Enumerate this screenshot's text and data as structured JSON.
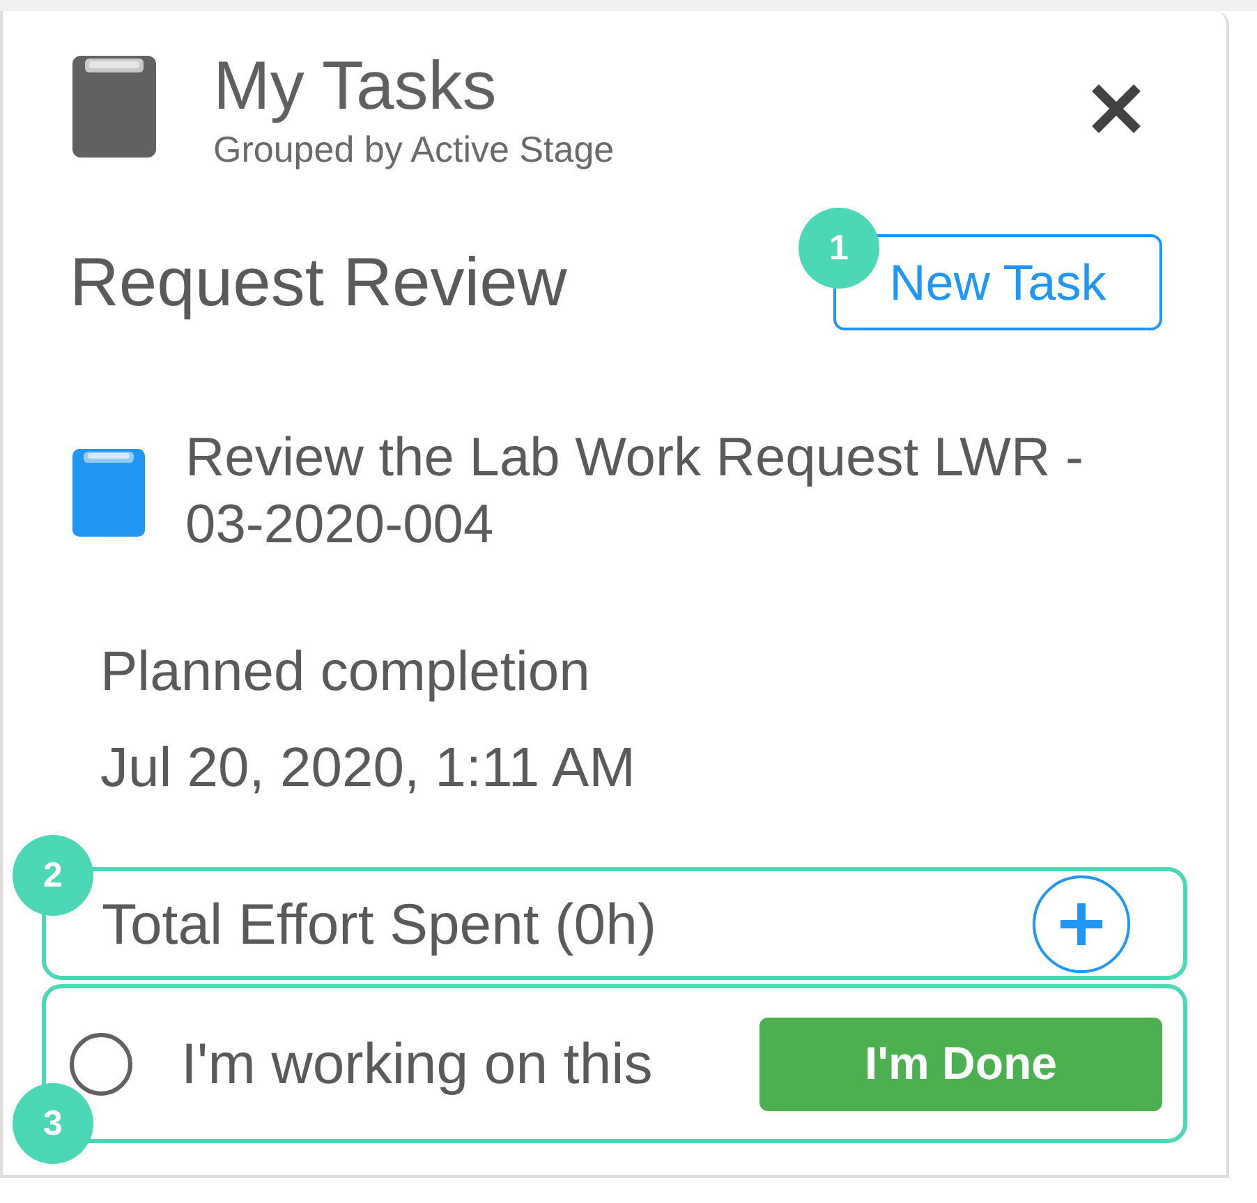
{
  "header": {
    "title": "My Tasks",
    "subtitle": "Grouped by Active Stage"
  },
  "stage": {
    "title": "Request Review",
    "button": "New Task",
    "callout": {
      "number": "1"
    }
  },
  "task": {
    "title": "Review the Lab Work Request LWR - 03-2020-004",
    "planned_label": "Planned completion",
    "planned_value": "Jul 20, 2020, 1:11 AM"
  },
  "effort_row": {
    "label": "Total Effort Spent (0h)",
    "callout": {
      "number": "2",
      "framed": true
    }
  },
  "status_row": {
    "working": {
      "label": "I'm working on this",
      "checked": false
    },
    "done_button": "I'm Done",
    "callout": {
      "number": "3",
      "framed": true
    }
  }
}
